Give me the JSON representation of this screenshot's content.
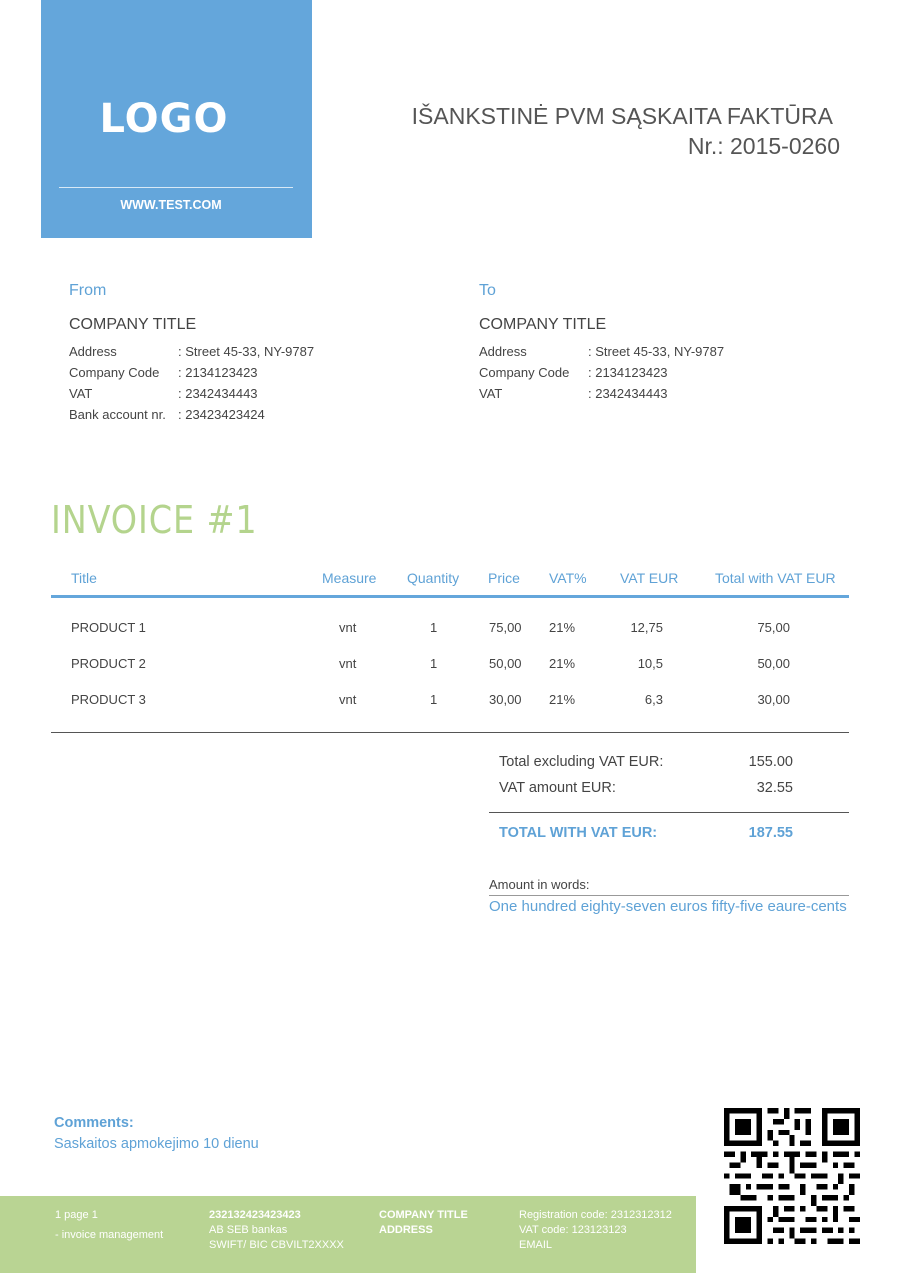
{
  "logo": {
    "text": "LOGO",
    "url": "WWW.TEST.COM"
  },
  "document": {
    "title": "IŠANKSTINĖ PVM SĄSKAITA FAKTŪRA",
    "number": "Nr.: 2015-0260"
  },
  "from": {
    "heading": "From",
    "company": "COMPANY TITLE",
    "rows": [
      {
        "label": "Address",
        "value": ": Street 45-33, NY-9787"
      },
      {
        "label": "Company Code",
        "value": ": 2134123423"
      },
      {
        "label": "VAT",
        "value": ": 2342434443"
      },
      {
        "label": "Bank account nr.",
        "value": ": 23423423424"
      }
    ]
  },
  "to": {
    "heading": "To",
    "company": "COMPANY TITLE",
    "rows": [
      {
        "label": "Address",
        "value": ": Street 45-33, NY-9787"
      },
      {
        "label": "Company Code",
        "value": ": 2134123423"
      },
      {
        "label": "VAT",
        "value": ": 2342434443"
      }
    ]
  },
  "invoice": {
    "title": "INVOICE #1"
  },
  "table": {
    "headers": [
      "Title",
      "Measure",
      "Quantity",
      "Price",
      "VAT%",
      "VAT EUR",
      "Total with VAT EUR"
    ],
    "rows": [
      [
        "PRODUCT 1",
        "vnt",
        "1",
        "75,00",
        "21%",
        "12,75",
        "75,00"
      ],
      [
        "PRODUCT 2",
        "vnt",
        "1",
        "50,00",
        "21%",
        "10,5",
        "50,00"
      ],
      [
        "PRODUCT 3",
        "vnt",
        "1",
        "30,00",
        "21%",
        "6,3",
        "30,00"
      ]
    ]
  },
  "totals": {
    "excl_label": "Total excluding VAT EUR:",
    "excl_value": "155.00",
    "vat_label": "VAT amount EUR:",
    "vat_value": "32.55",
    "grand_label": "TOTAL WITH VAT EUR:",
    "grand_value": "187.55"
  },
  "words": {
    "label": "Amount in words:",
    "value": "One hundred eighty-seven euros fifty-five eaure-cents"
  },
  "comments": {
    "label": "Comments:",
    "value": "Saskaitos apmokejimo 10 dienu"
  },
  "footer": {
    "col1": [
      "1 page 1",
      "- invoice management"
    ],
    "col2": [
      "232132423423423",
      "AB SEB bankas",
      "SWIFT/ BIC CBVILT2XXXX"
    ],
    "col3": [
      "COMPANY TITLE",
      "ADDRESS"
    ],
    "col4": [
      "Registration code: 2312312312",
      "VAT code: 123123123",
      "EMAIL"
    ]
  },
  "colors": {
    "accent_blue": "#64a6db",
    "accent_green": "#b9d493",
    "invoice_green": "#b4d48d",
    "text": "#444444"
  },
  "icons": {
    "qr": "qr-code-icon"
  }
}
